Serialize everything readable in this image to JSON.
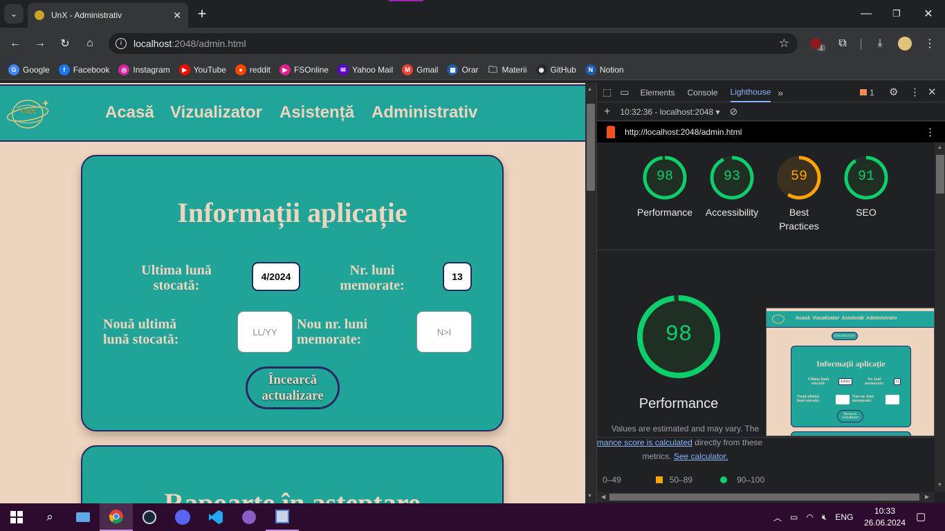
{
  "browser": {
    "tab_title": "UnX - Administrativ",
    "url_host": "localhost",
    "url_rest": ":2048/admin.html",
    "ext_badge": "1",
    "bookmarks": [
      {
        "label": "Google",
        "icon": "google-icon",
        "color": "#4285f4",
        "glyph": "G"
      },
      {
        "label": "Facebook",
        "icon": "facebook-icon",
        "color": "#1877f2",
        "glyph": "f"
      },
      {
        "label": "Instagram",
        "icon": "instagram-icon",
        "color": "#d6249f",
        "glyph": "◎"
      },
      {
        "label": "YouTube",
        "icon": "youtube-icon",
        "color": "#ff0000",
        "glyph": "▶"
      },
      {
        "label": "reddit",
        "icon": "reddit-icon",
        "color": "#ff4500",
        "glyph": "●"
      },
      {
        "label": "FSOnline",
        "icon": "fsonline-icon",
        "color": "#e0218a",
        "glyph": "▶"
      },
      {
        "label": "Yahoo Mail",
        "icon": "yahoo-mail-icon",
        "color": "#6001d2",
        "glyph": "✉"
      },
      {
        "label": "Gmail",
        "icon": "gmail-icon",
        "color": "#ea4335",
        "glyph": "M"
      },
      {
        "label": "Orar",
        "icon": "orar-icon",
        "color": "#1e5aa8",
        "glyph": "▦"
      },
      {
        "label": "Materii",
        "icon": "folder-icon",
        "color": "transparent",
        "glyph": "🗀"
      },
      {
        "label": "GitHub",
        "icon": "github-icon",
        "color": "#24292f",
        "glyph": "◉"
      },
      {
        "label": "Notion",
        "icon": "notion-icon",
        "color": "#1e5aa8",
        "glyph": "N"
      }
    ]
  },
  "site": {
    "logo_text": "UnX",
    "nav": [
      "Acasă",
      "Vizualizator",
      "Asistență",
      "Administrativ"
    ],
    "card1": {
      "title": "Informații aplicație",
      "last_month_label_1": "Ultima lună",
      "last_month_label_2": "stocată:",
      "last_month_value": "4/2024",
      "months_label_1": "Nr. luni",
      "months_label_2": "memorate:",
      "months_value": "13",
      "new_last_label_1": "Nouă ultimă",
      "new_last_label_2": "lună stocată:",
      "new_last_placeholder": "LL/YY",
      "new_months_label_1": "Nou nr. luni",
      "new_months_label_2": "memorate:",
      "new_months_placeholder": "N>I",
      "button_1": "Încearcă",
      "button_2": "actualizare"
    },
    "card2": {
      "title": "Rapoarte în așteptare"
    }
  },
  "devtools": {
    "tabs": [
      "Elements",
      "Console",
      "Lighthouse"
    ],
    "active_tab": "Lighthouse",
    "issues_count": "1",
    "report_time": "10:32:36 - localhost:2048",
    "report_url": "http://localhost:2048/admin.html",
    "scores": [
      {
        "value": 98,
        "label_1": "Performance",
        "label_2": "",
        "color": "#0cce6b",
        "bg": "#1f2f24"
      },
      {
        "value": 93,
        "label_1": "Accessibility",
        "label_2": "",
        "color": "#0cce6b",
        "bg": "#1f2f24"
      },
      {
        "value": 59,
        "label_1": "Best",
        "label_2": "Practices",
        "color": "#ffa400",
        "bg": "#3b2f1f"
      },
      {
        "value": 91,
        "label_1": "SEO",
        "label_2": "",
        "color": "#0cce6b",
        "bg": "#1f2f24"
      }
    ],
    "big_score": {
      "value": 98,
      "label": "Performance",
      "color": "#0cce6b"
    },
    "note_1": "Values are estimated and may vary. The",
    "note_link": "formance score is calculated",
    "note_2": " directly from these",
    "note_3": "metrics. ",
    "note_link_2": "See calculator.",
    "legend": [
      {
        "range": "0–49",
        "color": "#ff4e42",
        "shape": "triangle"
      },
      {
        "range": "50–89",
        "color": "#ffa400",
        "shape": "square"
      },
      {
        "range": "90–100",
        "color": "#0cce6b",
        "shape": "circle"
      }
    ],
    "thumb": {
      "nav": "Acasă  Vizualizator  Asistență  Administrativ",
      "disconnect": "Deconectare",
      "title": "Informații aplicație",
      "l1": "Ultima lună stocată:",
      "v1": "4/2024",
      "l2": "Nr. luni memorate:",
      "v2": "13",
      "l3": "Nouă ultimă lună stocată:",
      "l4": "Nou nr. luni memorate:",
      "btn": "Încearcă actualizare"
    }
  },
  "taskbar": {
    "lang": "ENG",
    "time": "10:33",
    "date": "26.06.2024"
  }
}
